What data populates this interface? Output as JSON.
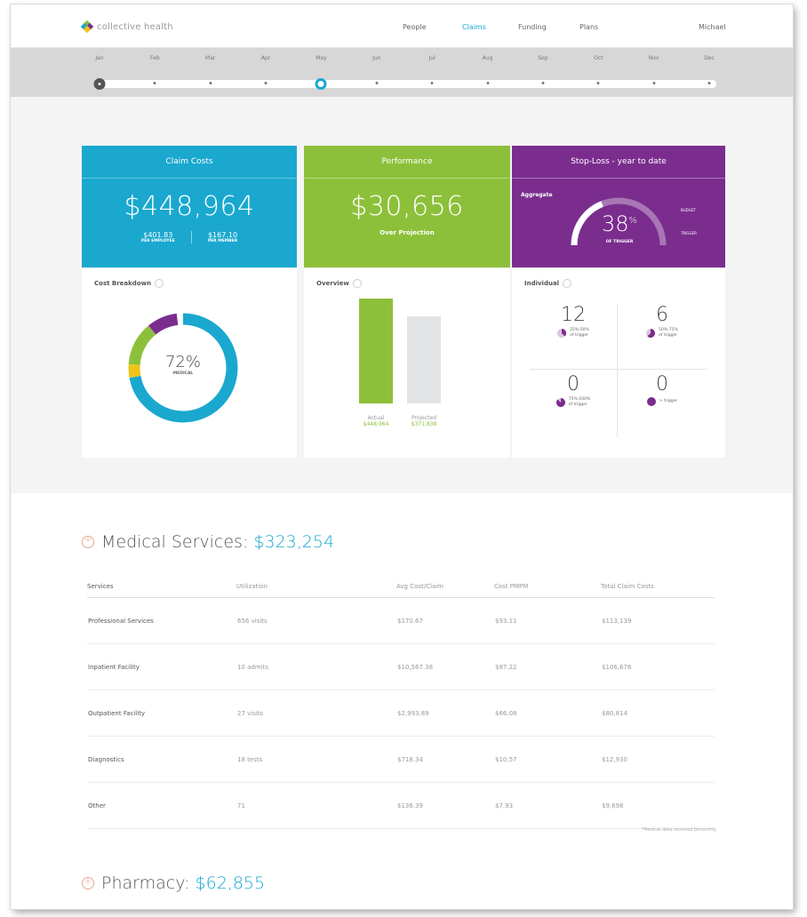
{
  "nav": {
    "logo_text": "collective health",
    "links": [
      "People",
      "Claims",
      "Funding",
      "Plans"
    ],
    "active": "Claims",
    "user": "Michael"
  },
  "timeline": {
    "months": [
      "Jan",
      "Feb",
      "Mar",
      "Apr",
      "May",
      "Jun",
      "Jul",
      "Aug",
      "Sep",
      "Oct",
      "Nov",
      "Dec"
    ],
    "current": "May"
  },
  "claim_costs": {
    "title": "Claim Costs",
    "value": "$448,964",
    "per_employee_value": "$401.83",
    "per_employee_label": "PER EMPLOYEE",
    "per_member_value": "$167.10",
    "per_member_label": "PER MEMBER",
    "color": "#1aa8cf"
  },
  "performance": {
    "title": "Performance",
    "value": "$30,656",
    "label": "Over Projection",
    "color": "#8dc03a"
  },
  "stop_loss": {
    "title": "Stop-Loss - year to date",
    "aggregate_label": "Aggregate",
    "percent": "38",
    "percent_sign": "%",
    "percent_caption": "OF TRIGGER",
    "gauge_fraction": 0.38,
    "legend_1": "BUDGET",
    "legend_2": "TRIGGER",
    "color": "#7b2d8e"
  },
  "cost_breakdown": {
    "title": "Cost Breakdown",
    "percent": "72%",
    "percent_label": "MEDICAL",
    "segments": [
      {
        "fraction": 0.72,
        "color": "#1aa8cf"
      },
      {
        "fraction": 0.04,
        "color": "#f0c419"
      },
      {
        "fraction": 0.13,
        "color": "#8dc03a"
      },
      {
        "fraction": 0.09,
        "color": "#7b2d8e"
      }
    ]
  },
  "overview": {
    "title": "Overview",
    "actual_label": "Actual",
    "actual_value": "$448,964",
    "projected_label": "Projected",
    "projected_value": "$371,838",
    "actual_amount": 448964,
    "projected_amount": 371838
  },
  "individual": {
    "title": "Individual",
    "cells": [
      {
        "count": "12",
        "line1": "25%-50%",
        "line2": "of trigger",
        "fill": 0.375
      },
      {
        "count": "6",
        "line1": "50%-75%",
        "line2": "of trigger",
        "fill": 0.625
      },
      {
        "count": "0",
        "line1": "75%-100%",
        "line2": "of trigger",
        "fill": 0.875
      },
      {
        "count": "0",
        "line1": "> trigger",
        "line2": "",
        "fill": 1.0
      }
    ]
  },
  "medical_services": {
    "title": "Medical Services:",
    "amount": "$323,254",
    "headers": [
      "Services",
      "Utilization",
      "Avg Cost/Claim",
      "Cost PMPM",
      "Total Claim Costs"
    ],
    "rows": [
      [
        "Professional Services",
        "656 visits",
        "$170.67",
        "$93.11",
        "$113,139"
      ],
      [
        "Inpatient Facility",
        "10 admits",
        "$10,567.38",
        "$87.22",
        "$106,676"
      ],
      [
        "Outpatient Facility",
        "27 visits",
        "$2,993.89",
        "$66.08",
        "$80,814"
      ],
      [
        "Diagnostics",
        "18 tests",
        "$718.34",
        "$10.57",
        "$12,930"
      ],
      [
        "Other",
        "71",
        "$136.39",
        "$7.93",
        "$9,698"
      ]
    ],
    "footnote": "*Medical data received bimonthly"
  },
  "pharmacy": {
    "title": "Pharmacy:",
    "amount": "$62,855"
  }
}
